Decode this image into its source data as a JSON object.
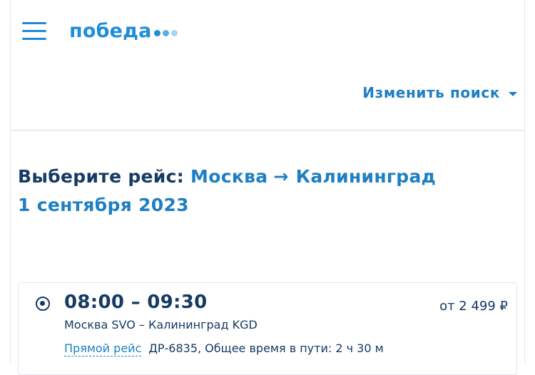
{
  "header": {
    "logo_text": "победа",
    "logo_dot_colors": [
      "#1f8ed8",
      "#5aaee6",
      "#a9d3f2"
    ],
    "change_search_label": "Изменить поиск"
  },
  "heading": {
    "prefix": "Выберите рейс:",
    "from": "Москва",
    "arrow": "→",
    "to": "Калининград",
    "date": "1 сентября 2023"
  },
  "flights": [
    {
      "selected": true,
      "times": "08:00 – 09:30",
      "price": "от 2 499 ₽",
      "route": "Москва SVO – Калининград KGD",
      "type_label": "Прямой рейс",
      "info": "ДР-6835, Общее время в пути: 2 ч 30 м"
    }
  ],
  "colors": {
    "accent": "#1e7fc2",
    "dark_text": "#163a63",
    "logo": "#1f8ed8"
  }
}
